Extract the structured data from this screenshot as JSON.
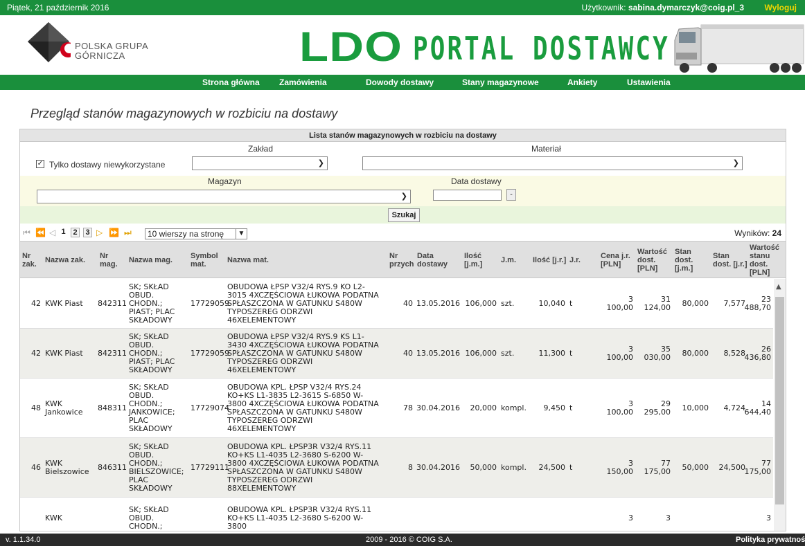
{
  "topbar": {
    "date": "Piątek, 21 październik 2016",
    "user_label": "Użytkownik:",
    "user_name": "sabina.dymarczyk@coig.pl_3",
    "logout": "Wyloguj"
  },
  "header": {
    "logo_line1": "POLSKA GRUPA",
    "logo_line2": "GÓRNICZA",
    "ldo": "LDO",
    "portal": "PORTAL DOSTAWCY",
    "brand_color": "#1a9c3e"
  },
  "nav": [
    "Strona główna",
    "Zamówienia",
    "Dowody dostawy",
    "Stany magazynowe",
    "Ankiety",
    "Ustawienia"
  ],
  "page_title": "Przegląd stanów magazynowych w rozbiciu na dostawy",
  "panel": {
    "title": "Lista stanów magazynowych w rozbiciu na dostawy",
    "zaklad_label": "Zakład",
    "material_label": "Materiał",
    "checkbox_label": "Tylko dostawy niewykorzystane",
    "checkbox_checked": true,
    "magazyn_label": "Magazyn",
    "data_dostawy_label": "Data dostawy",
    "date_button": "-",
    "search_button": "Szukaj"
  },
  "pager": {
    "pages": [
      "1",
      "2",
      "3"
    ],
    "current": "1",
    "rows_per_page": "10 wierszy na stronę",
    "results_label": "Wyników:",
    "results_count": "24"
  },
  "columns": [
    "Nr zak.",
    "Nazwa zak.",
    "Nr mag.",
    "Nazwa mag.",
    "Symbol mat.",
    "Nazwa mat.",
    "Nr przych",
    "Data dostawy",
    "Ilość [j.m.]",
    "J.m.",
    "Ilość [j.r.]",
    "J.r.",
    "Cena j.r. [PLN]",
    "Wartość dost. [PLN]",
    "Stan dost. [j.m.]",
    "Stan dost. [j.r.]",
    "Wartość stanu dost. [PLN]"
  ],
  "rows": [
    [
      "42",
      "KWK Piast",
      "842311",
      "SK; SKŁAD OBUD. CHODN.; PIAST; PLAC SKŁADOWY",
      "17729059",
      "OBUDOWA ŁPSP V32/4 RYS.9 KO L2-3015 4XCZĘŚCIOWA ŁUKOWA PODATNA SPŁASZCZONA W GATUNKU S480W TYPOSZEREG ODRZWI 46XELEMENTOWY",
      "40",
      "13.05.2016",
      "106,000",
      "szt.",
      "10,040",
      "t",
      "3 100,00",
      "31 124,00",
      "80,000",
      "7,577",
      "23 488,70"
    ],
    [
      "42",
      "KWK Piast",
      "842311",
      "SK; SKŁAD OBUD. CHODN.; PIAST; PLAC SKŁADOWY",
      "17729059",
      "OBUDOWA ŁPSP V32/4 RYS.9 KS L1-3430 4XCZĘŚCIOWA ŁUKOWA PODATNA SPŁASZCZONA W GATUNKU S480W TYPOSZEREG ODRZWI 46XELEMENTOWY",
      "40",
      "13.05.2016",
      "106,000",
      "szt.",
      "11,300",
      "t",
      "3 100,00",
      "35 030,00",
      "80,000",
      "8,528",
      "26 436,80"
    ],
    [
      "48",
      "KWK Jankowice",
      "848311",
      "SK; SKŁAD OBUD. CHODN.; JANKOWICE; PLAC SKŁADOWY",
      "17729074",
      "OBUDOWA KPL. ŁPSP V32/4 RYS.24 KO+KS L1-3835 L2-3615 S-6850 W-3800 4XCZĘŚCIOWA ŁUKOWA PODATNA SPŁASZCZONA W GATUNKU S480W TYPOSZEREG ODRZWI 46XELEMENTOWY",
      "78",
      "30.04.2016",
      "20,000",
      "kompl.",
      "9,450",
      "t",
      "3 100,00",
      "29 295,00",
      "10,000",
      "4,724",
      "14 644,40"
    ],
    [
      "46",
      "KWK Bielszowice",
      "846311",
      "SK; SKŁAD OBUD. CHODN.; BIELSZOWICE; PLAC SKŁADOWY",
      "17729111",
      "OBUDOWA KPL. ŁPSP3R V32/4 RYS.11 KO+KS L1-4035 L2-3680 S-6200 W-3800 4XCZĘŚCIOWA ŁUKOWA PODATNA SPŁASZCZONA W GATUNKU S480W TYPOSZEREG ODRZWI 88XELEMENTOWY",
      "8",
      "30.04.2016",
      "50,000",
      "kompl.",
      "24,500",
      "t",
      "3 150,00",
      "77 175,00",
      "50,000",
      "24,500",
      "77 175,00"
    ],
    [
      "",
      "KWK",
      "",
      "SK; SKŁAD OBUD. CHODN.;",
      "",
      "OBUDOWA KPL. ŁPSP3R V32/4 RYS.11 KO+KS L1-4035 L2-3680 S-6200 W-3800",
      "",
      "",
      "",
      "",
      "",
      "",
      "3",
      "3",
      "",
      "",
      "3"
    ]
  ],
  "footer": {
    "version": "v. 1.1.34.0",
    "copyright": "2009 - 2016 © COIG S.A.",
    "privacy": "Polityka prywatności"
  }
}
